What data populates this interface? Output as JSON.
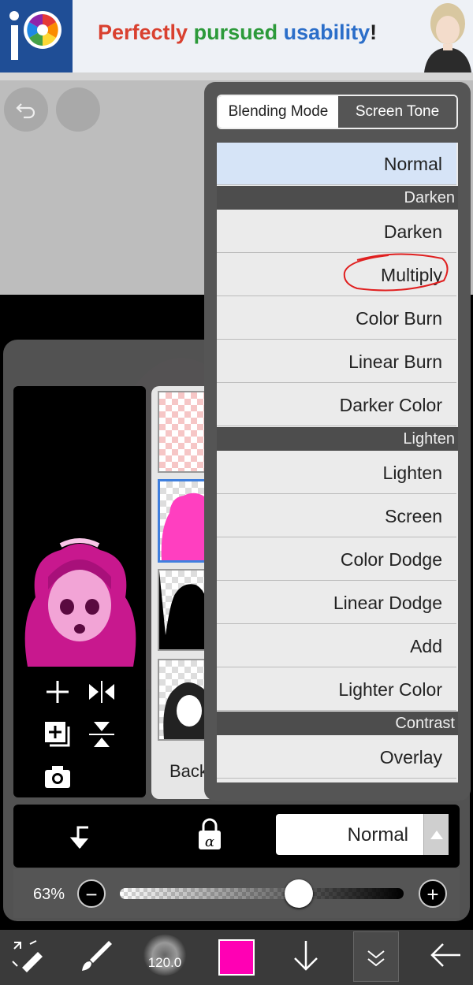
{
  "ad": {
    "word1": "Perfectly",
    "word2": "pursued",
    "word3": "usability",
    "word4": "!"
  },
  "blend_popup": {
    "tabs": [
      "Blending Mode",
      "Screen Tone"
    ],
    "active_tab": "Blending Mode",
    "items": [
      {
        "kind": "item",
        "label": "Normal",
        "selected": true
      },
      {
        "kind": "group",
        "label": "Darken"
      },
      {
        "kind": "item",
        "label": "Darken"
      },
      {
        "kind": "item",
        "label": "Multiply",
        "annotated": true
      },
      {
        "kind": "item",
        "label": "Color Burn"
      },
      {
        "kind": "item",
        "label": "Linear Burn"
      },
      {
        "kind": "item",
        "label": "Darker Color"
      },
      {
        "kind": "group",
        "label": "Lighten"
      },
      {
        "kind": "item",
        "label": "Lighten"
      },
      {
        "kind": "item",
        "label": "Screen"
      },
      {
        "kind": "item",
        "label": "Color Dodge"
      },
      {
        "kind": "item",
        "label": "Linear Dodge"
      },
      {
        "kind": "item",
        "label": "Add"
      },
      {
        "kind": "item",
        "label": "Lighter Color"
      },
      {
        "kind": "group",
        "label": "Contrast"
      },
      {
        "kind": "item",
        "label": "Overlay"
      }
    ],
    "annotation_color": "#e02020"
  },
  "layer_panel": {
    "background_label": "Backg",
    "blend_mode_value": "Normal",
    "opacity_label": "63%",
    "opacity": 0.63
  },
  "bottom_toolbar": {
    "brush_size": "120.0",
    "color": "#ff00b4"
  },
  "colors": {
    "selection": "#3f7fde",
    "layer_color": "#ff3fc0"
  }
}
